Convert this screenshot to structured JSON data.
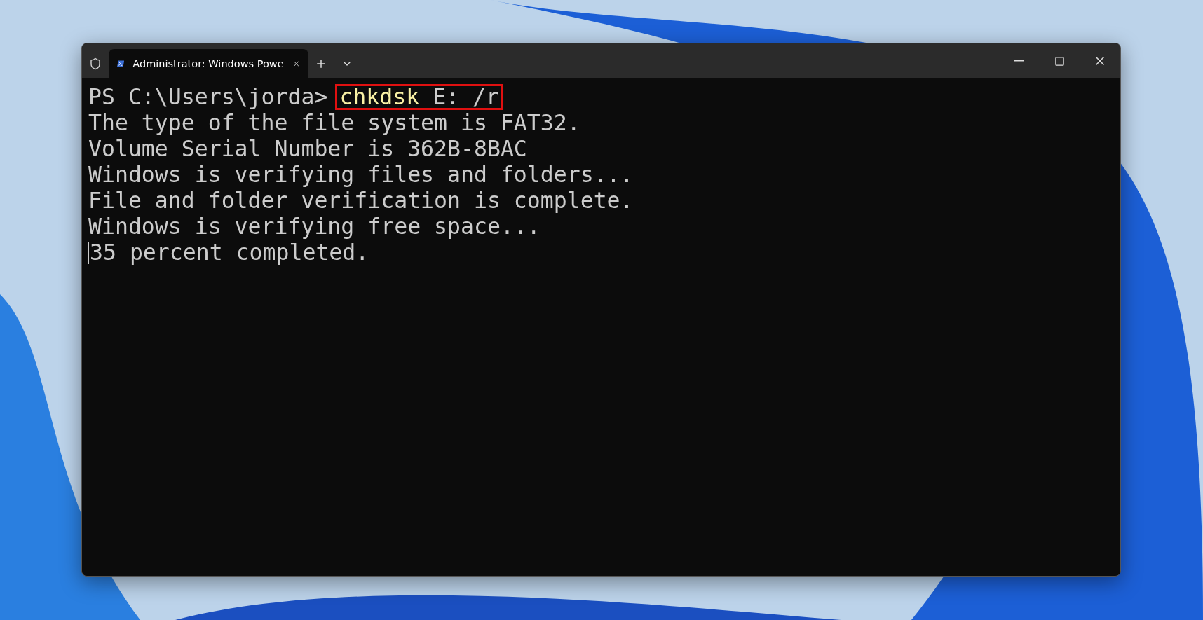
{
  "window": {
    "tabs": [
      {
        "title": "Administrator: Windows Powe",
        "selected": true
      }
    ]
  },
  "terminal": {
    "prompt": "PS C:\\Users\\jorda>",
    "command": {
      "program": "chkdsk",
      "args": "E: /r",
      "highlighted": true
    },
    "output": [
      "The type of the file system is FAT32.",
      "Volume Serial Number is 362B-8BAC",
      "Windows is verifying files and folders...",
      "File and folder verification is complete.",
      "Windows is verifying free space...",
      "35 percent completed."
    ]
  }
}
